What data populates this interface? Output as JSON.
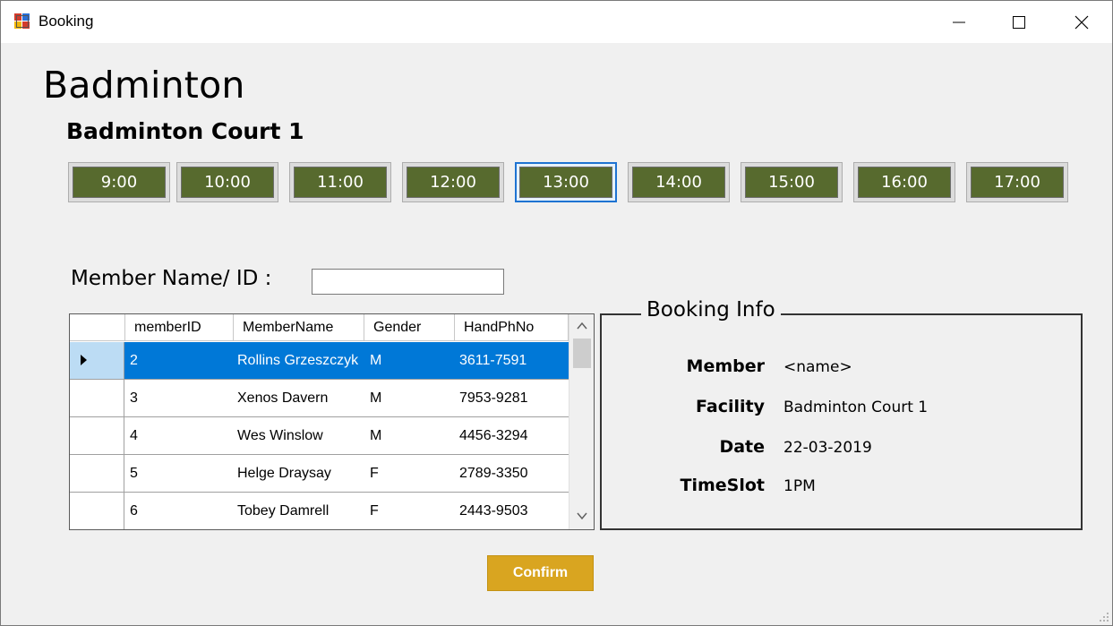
{
  "window": {
    "title": "Booking",
    "icon": "form-app-icon",
    "controls": [
      "minimize-icon",
      "maximize-icon",
      "close-icon"
    ]
  },
  "page": {
    "heading": "Badminton",
    "court_name": "Badminton Court 1"
  },
  "timeslots": {
    "selected_index": 4,
    "button_color": "#576a2e",
    "items": [
      {
        "label": "9:00"
      },
      {
        "label": "10:00"
      },
      {
        "label": "11:00"
      },
      {
        "label": "12:00"
      },
      {
        "label": "13:00"
      },
      {
        "label": "14:00"
      },
      {
        "label": "15:00"
      },
      {
        "label": "16:00"
      },
      {
        "label": "17:00"
      }
    ]
  },
  "search": {
    "label": "Member Name/ ID :",
    "value": ""
  },
  "members_grid": {
    "columns": [
      "memberID",
      "MemberName",
      "Gender",
      "HandPhNo"
    ],
    "selected_row": 0,
    "selection_color": "#0078d7",
    "rows": [
      {
        "memberID": "2",
        "MemberName": "Rollins Grzeszczyk",
        "Gender": "M",
        "HandPhNo": "3611-7591"
      },
      {
        "memberID": "3",
        "MemberName": "Xenos Davern",
        "Gender": "M",
        "HandPhNo": "7953-9281"
      },
      {
        "memberID": "4",
        "MemberName": "Wes Winslow",
        "Gender": "M",
        "HandPhNo": "4456-3294"
      },
      {
        "memberID": "5",
        "MemberName": "Helge Draysay",
        "Gender": "F",
        "HandPhNo": "2789-3350"
      },
      {
        "memberID": "6",
        "MemberName": "Tobey Damrell",
        "Gender": "F",
        "HandPhNo": "2443-9503"
      }
    ]
  },
  "booking_info": {
    "title": "Booking Info",
    "fields": [
      {
        "label": "Member",
        "value": "<name>"
      },
      {
        "label": "Facility",
        "value": "Badminton Court 1"
      },
      {
        "label": "Date",
        "value": "22-03-2019"
      },
      {
        "label": "TimeSlot",
        "value": "1PM"
      }
    ]
  },
  "actions": {
    "confirm_label": "Confirm",
    "confirm_color": "#d9a520"
  }
}
